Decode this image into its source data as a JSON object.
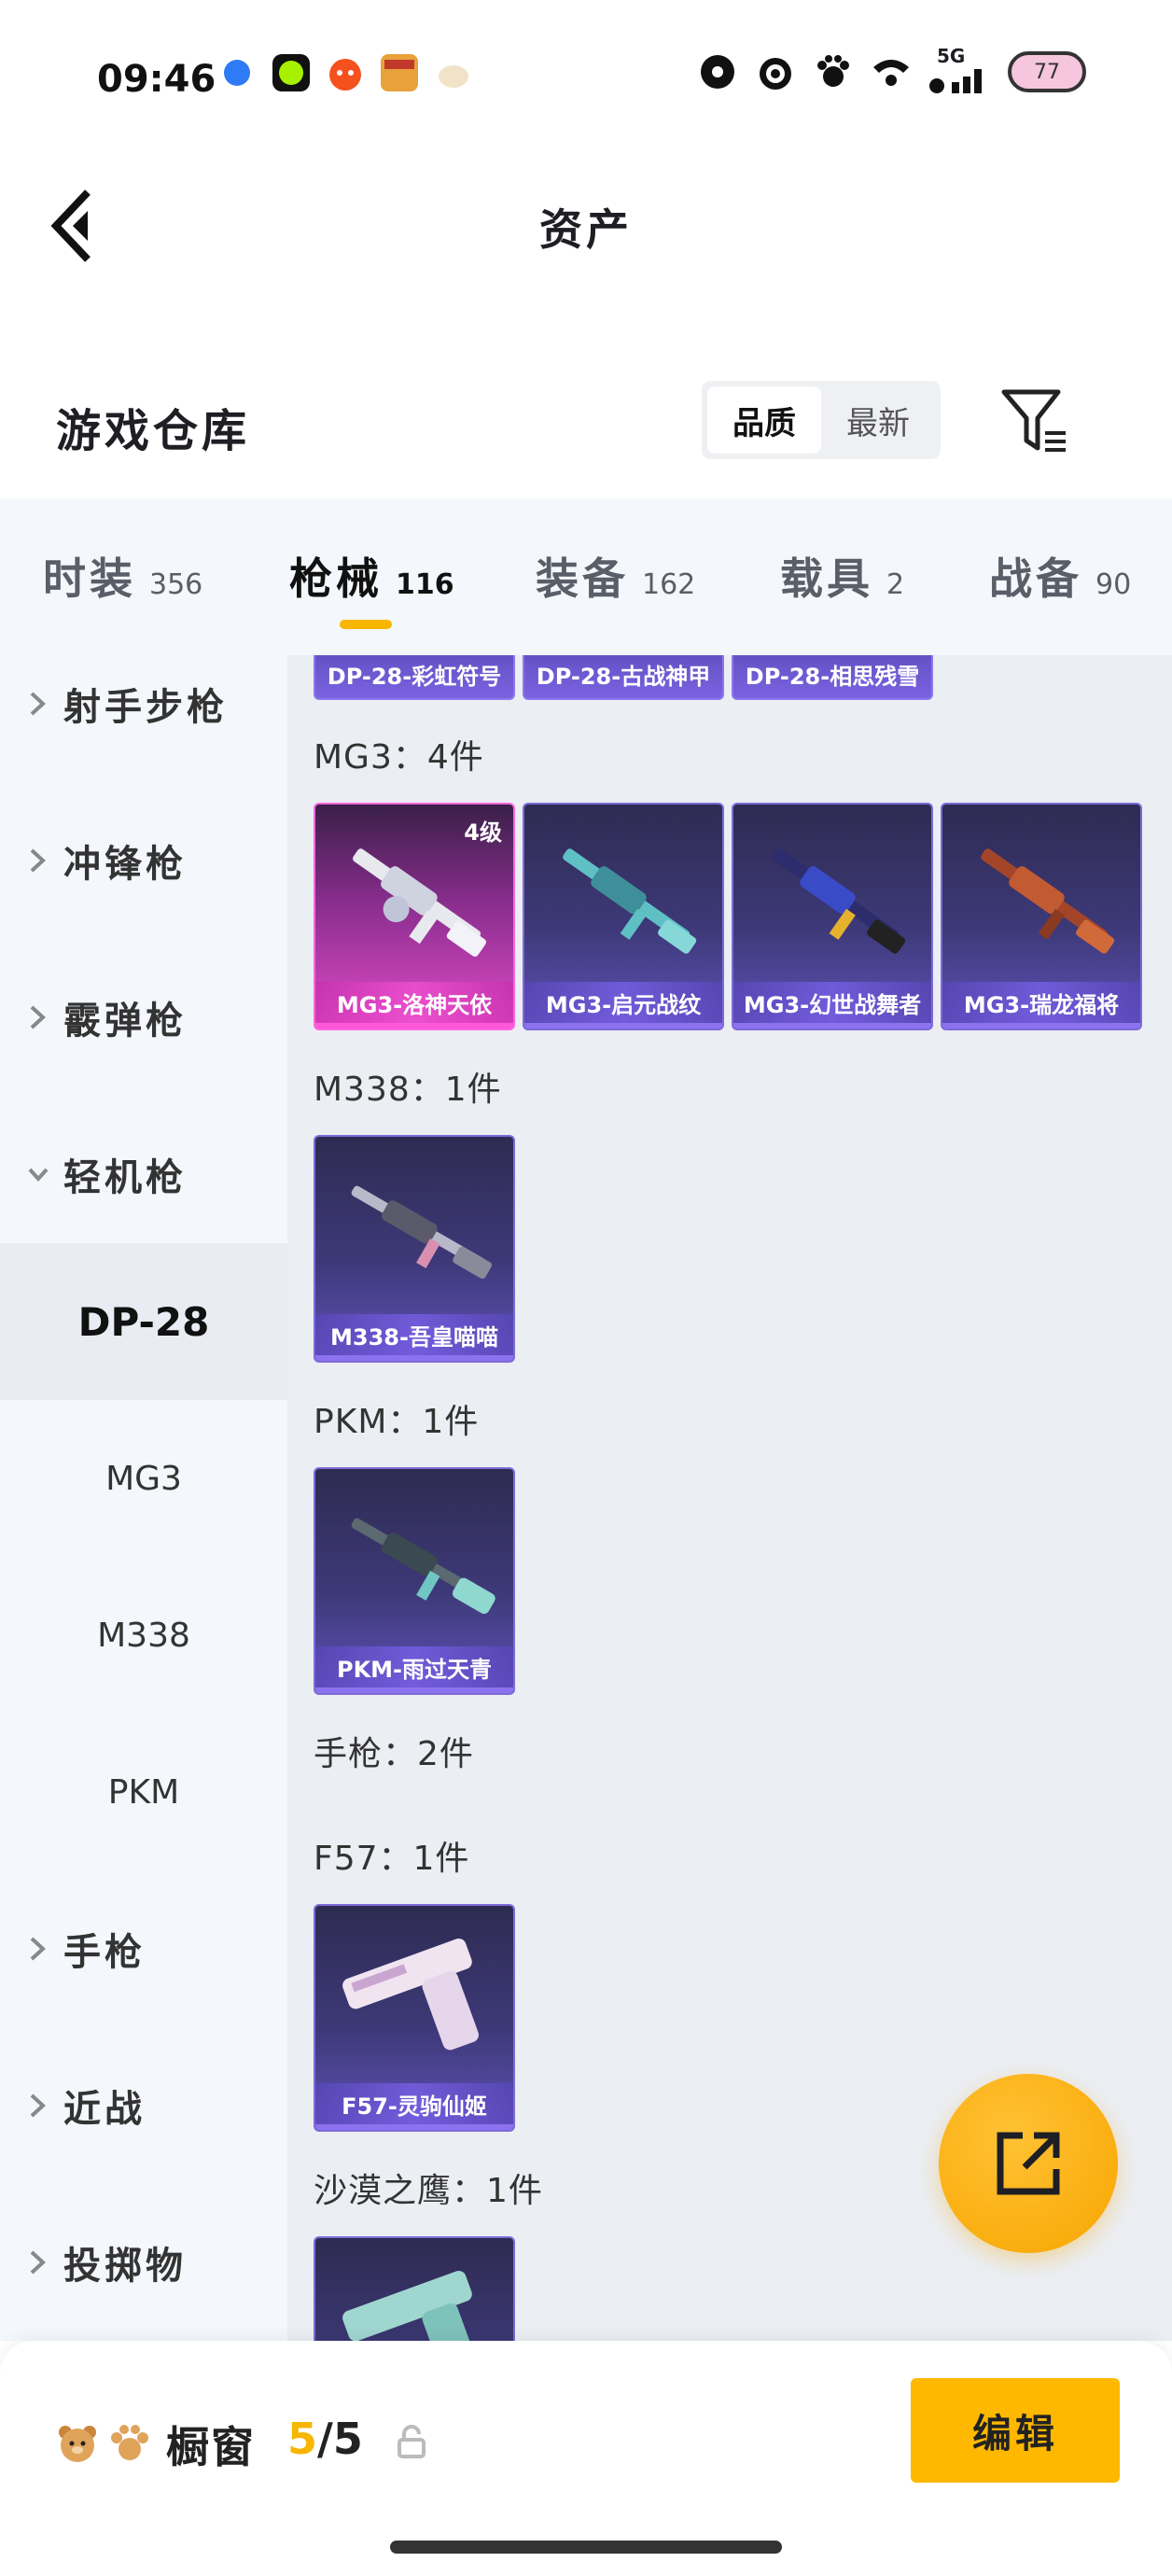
{
  "status_bar": {
    "time": "09:46",
    "network": "5G",
    "battery": "77"
  },
  "header": {
    "title": "资产"
  },
  "warehouse": {
    "title": "游戏仓库",
    "sort_options": [
      "品质",
      "最新"
    ],
    "active_sort": "品质"
  },
  "tabs": [
    {
      "label": "时装",
      "count": "356"
    },
    {
      "label": "枪械",
      "count": "116"
    },
    {
      "label": "装备",
      "count": "162"
    },
    {
      "label": "载具",
      "count": "2"
    },
    {
      "label": "战备",
      "count": "90"
    }
  ],
  "sidebar": {
    "categories": [
      "射手步枪",
      "冲锋枪",
      "霰弹枪",
      "轻机枪"
    ],
    "sub_items": [
      "DP-28",
      "MG3",
      "M338",
      "PKM"
    ],
    "more_categories": [
      "手枪",
      "近战",
      "投掷物"
    ]
  },
  "content": {
    "top_strip": [
      "DP-28-彩虹符号",
      "DP-28-古战神甲",
      "DP-28-相思残雪"
    ],
    "groups": [
      {
        "label": "MG3：4件",
        "items": [
          {
            "name": "MG3-洛神天依",
            "level": "4级"
          },
          {
            "name": "MG3-启元战纹"
          },
          {
            "name": "MG3-幻世战舞者"
          },
          {
            "name": "MG3-瑞龙福将"
          }
        ]
      },
      {
        "label": "M338：1件",
        "items": [
          {
            "name": "M338-吾皇喵喵"
          }
        ]
      },
      {
        "label": "PKM：1件",
        "items": [
          {
            "name": "PKM-雨过天青"
          }
        ]
      },
      {
        "label": "手枪：2件",
        "items": []
      },
      {
        "label": "F57：1件",
        "items": [
          {
            "name": "F57-灵驹仙姬"
          }
        ]
      },
      {
        "label": "沙漠之鹰：1件",
        "items": [
          {
            "name": ""
          }
        ]
      }
    ]
  },
  "bottom_bar": {
    "label": "橱窗",
    "count_current": "5",
    "count_total": "/5",
    "edit_label": "编辑"
  },
  "colors": {
    "accent": "#ffb800",
    "tab_bg": "#f4f7fb",
    "content_bg": "#ebeef3",
    "card_purple": "#3d3978",
    "card_pink": "#e14bc6"
  }
}
